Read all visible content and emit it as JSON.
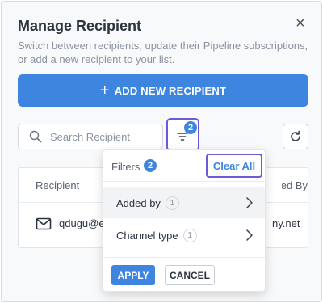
{
  "modal": {
    "title": "Manage Recipient",
    "subtitle": "Switch between recipients, update their Pipeline subscriptions, or add a new recipient to your list.",
    "close_glyph": "×"
  },
  "add_button": {
    "label": "ADD NEW RECIPIENT",
    "plus": "+"
  },
  "search": {
    "placeholder": "Search Recipient",
    "value": ""
  },
  "filter_button": {
    "badge": "2"
  },
  "table": {
    "columns": [
      "Recipient",
      "Added By"
    ],
    "rows": [
      {
        "recipient": "qdugu@e",
        "added_by": "ny.net"
      }
    ]
  },
  "filters": {
    "title": "Filters",
    "count": "2",
    "clear_label": "Clear All",
    "items": [
      {
        "label": "Added by",
        "count": "1"
      },
      {
        "label": "Channel type",
        "count": "1"
      }
    ],
    "apply_label": "APPLY",
    "cancel_label": "CANCEL"
  },
  "colors": {
    "accent": "#3d85de",
    "focus_outline": "#6e5ad8",
    "text": "#2c3440",
    "muted": "#8b93a1"
  }
}
